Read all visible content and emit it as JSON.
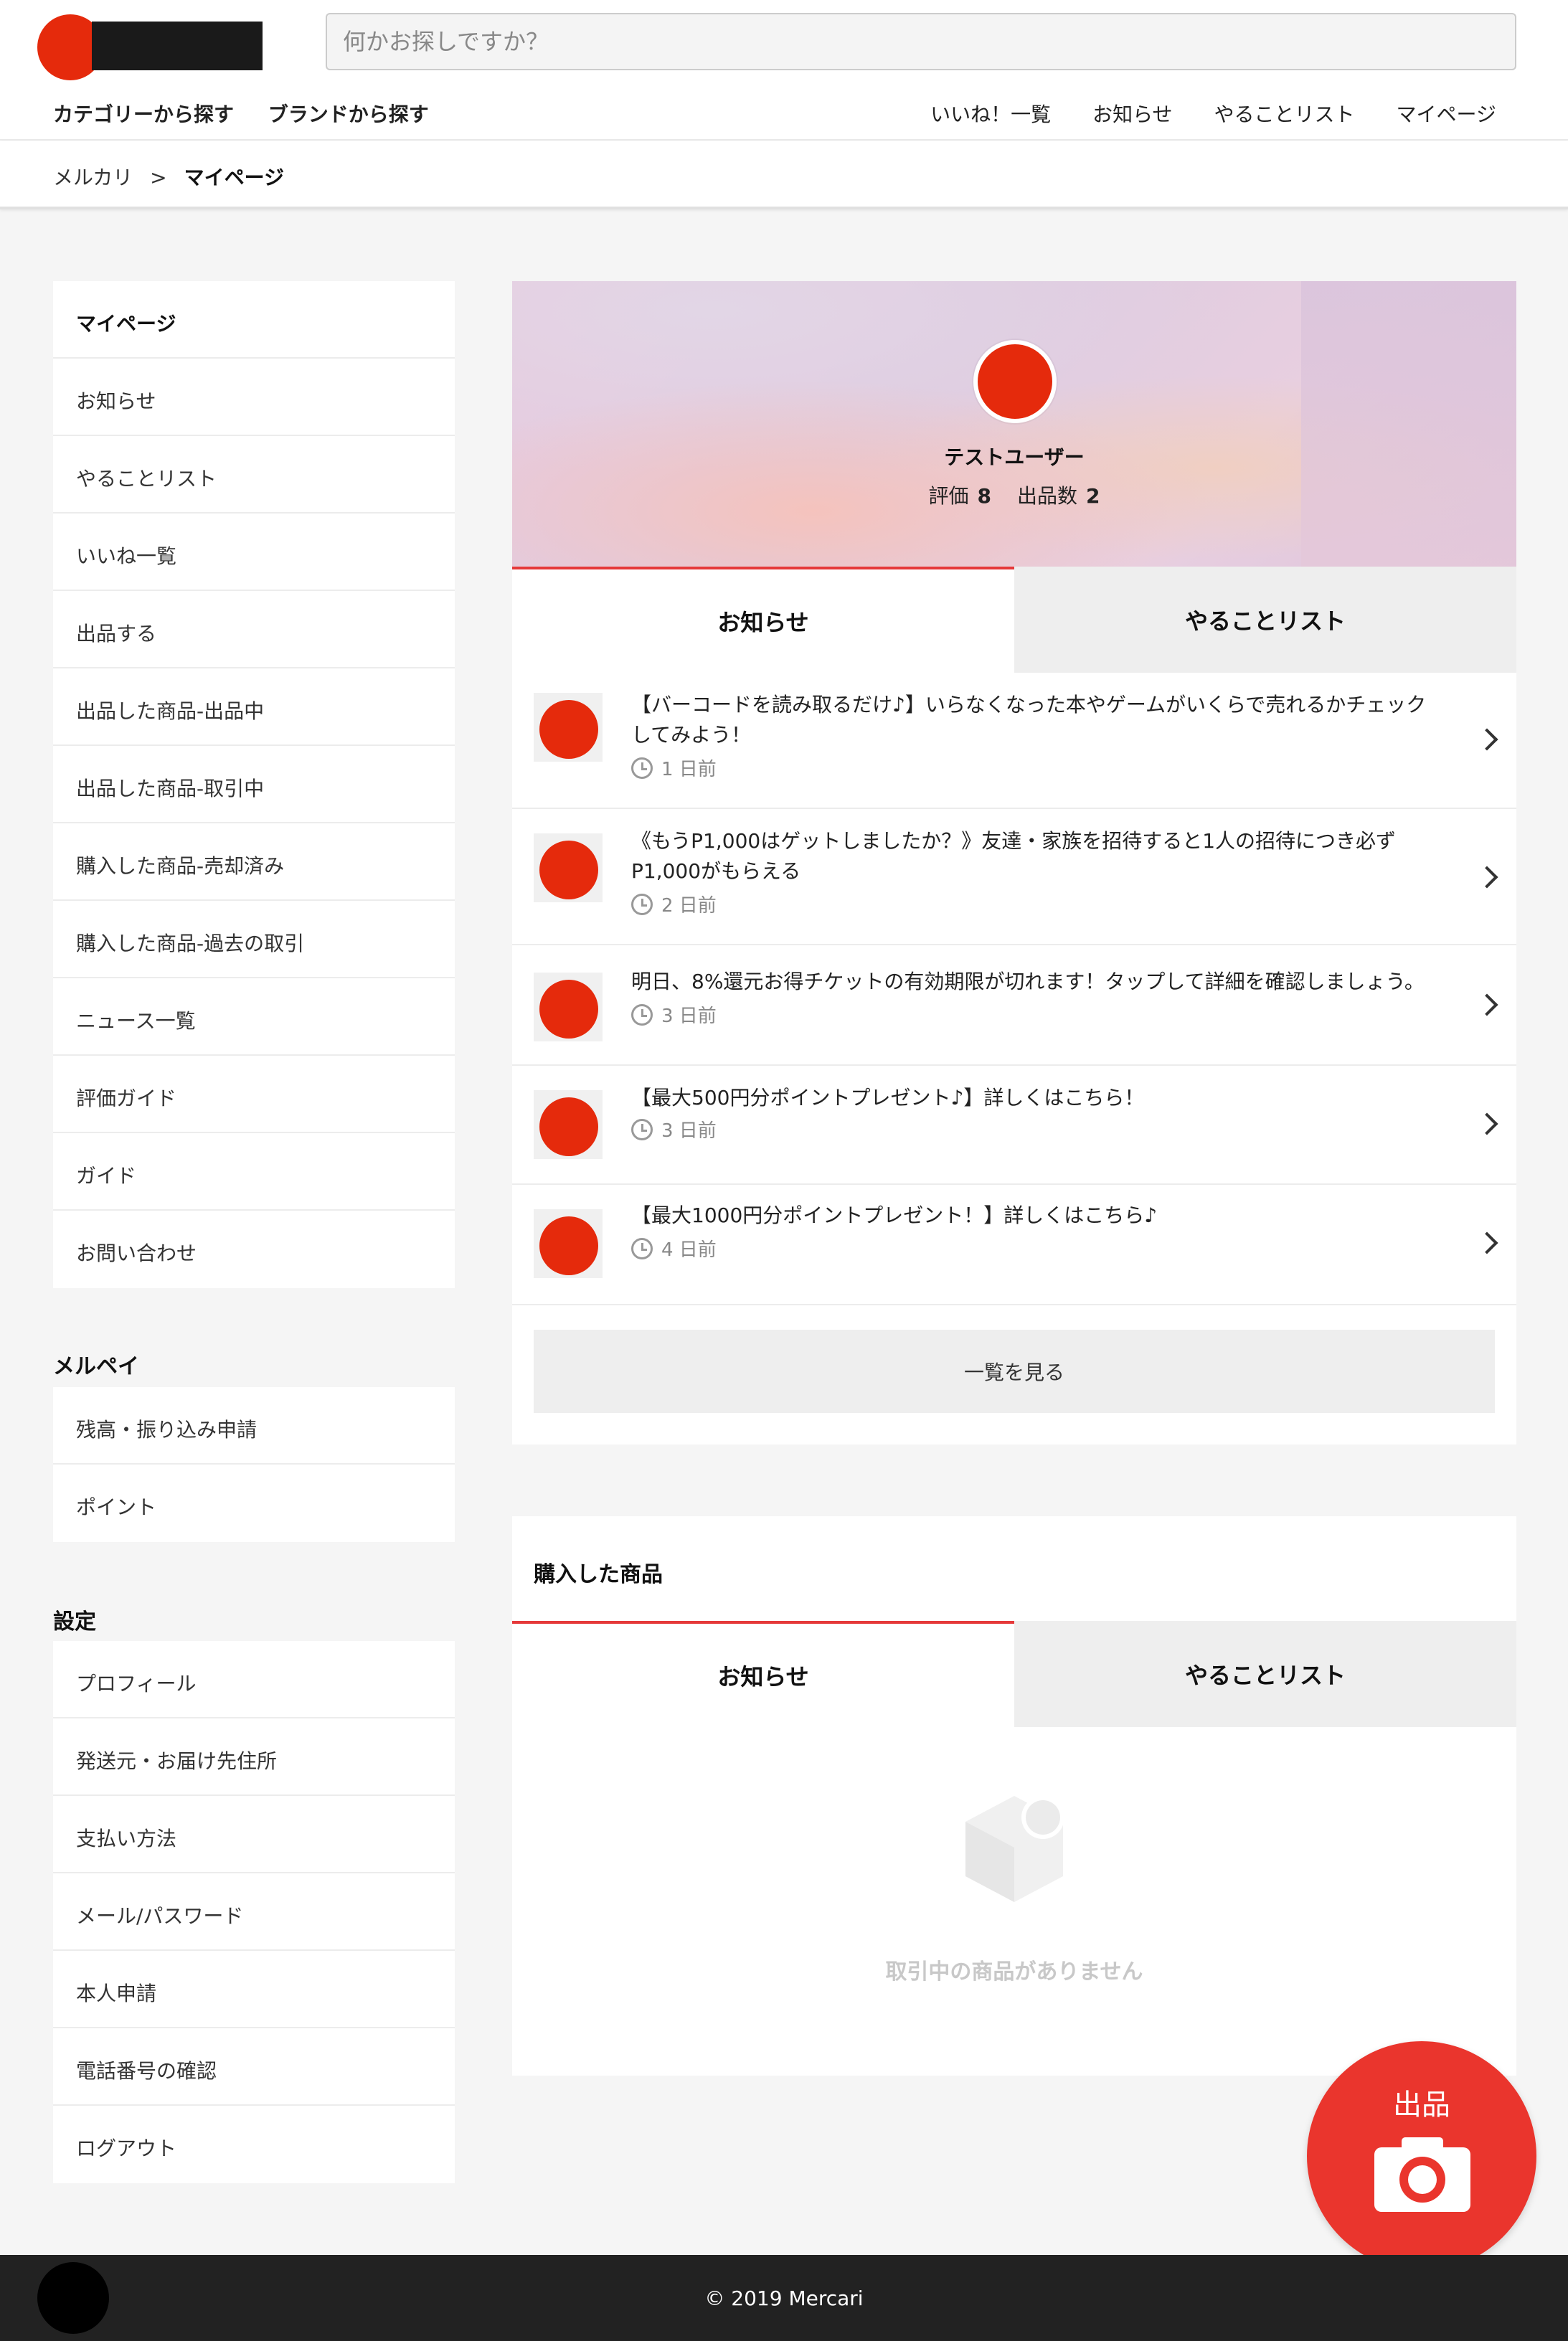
{
  "header": {
    "search_placeholder": "何かお探しですか？",
    "category_nav": [
      "カテゴリーから探す",
      "ブランドから探す"
    ],
    "top_nav": [
      "いいね！一覧",
      "お知らせ",
      "やることリスト",
      "マイページ"
    ]
  },
  "breadcrumb": {
    "root": "メルカリ",
    "separator": ">",
    "current": "マイページ"
  },
  "sidebar": {
    "mypage": [
      "マイページ",
      "お知らせ",
      "やることリスト",
      "いいね一覧",
      "出品する",
      "出品した商品-出品中",
      "出品した商品-取引中",
      "購入した商品-売却済み",
      "購入した商品-過去の取引",
      "ニュース一覧",
      "評価ガイド",
      "ガイド",
      "お問い合わせ"
    ],
    "merpay_heading": "メルペイ",
    "merpay": [
      "残高・振り込み申請",
      "ポイント"
    ],
    "settings_heading": "設定",
    "settings": [
      "プロフィール",
      "発送元・お届け先住所",
      "支払い方法",
      "メール/パスワード",
      "本人申請",
      "電話番号の確認",
      "ログアウト"
    ]
  },
  "profile": {
    "username": "テストユーザー",
    "rating_label": "評価",
    "rating_value": "8",
    "listings_label": "出品数",
    "listings_value": "2"
  },
  "tabs": {
    "notices": "お知らせ",
    "todo": "やることリスト"
  },
  "notices": [
    {
      "text": "【バーコードを読み取るだけ♪】いらなくなった本やゲームがいくらで売れるかチェックしてみよう！",
      "time": "1 日前"
    },
    {
      "text": "《もうP1,000はゲットしましたか？》友達・家族を招待すると1人の招待につき必ずP1,000がもらえる",
      "time": "2 日前"
    },
    {
      "text": "明日、8%還元お得チケットの有効期限が切れます！タップして詳細を確認しましょう。",
      "time": "3 日前"
    },
    {
      "text": "【最大500円分ポイントプレゼント♪】詳しくはこちら！",
      "time": "3 日前"
    },
    {
      "text": "【最大1000円分ポイントプレゼント！】詳しくはこちら♪",
      "time": "4 日前"
    }
  ],
  "see_all": "一覧を見る",
  "purchased": {
    "title": "購入した商品",
    "tab_notices": "お知らせ",
    "tab_todo": "やることリスト",
    "empty_message": "取引中の商品がありません"
  },
  "fab": {
    "label": "出品",
    "icon": "camera-icon"
  },
  "footer": {
    "copyright": "© 2019 Mercari"
  },
  "colors": {
    "brand_red": "#e52a0c",
    "fab_red": "#ea352d",
    "tab_accent": "#e5393a"
  }
}
